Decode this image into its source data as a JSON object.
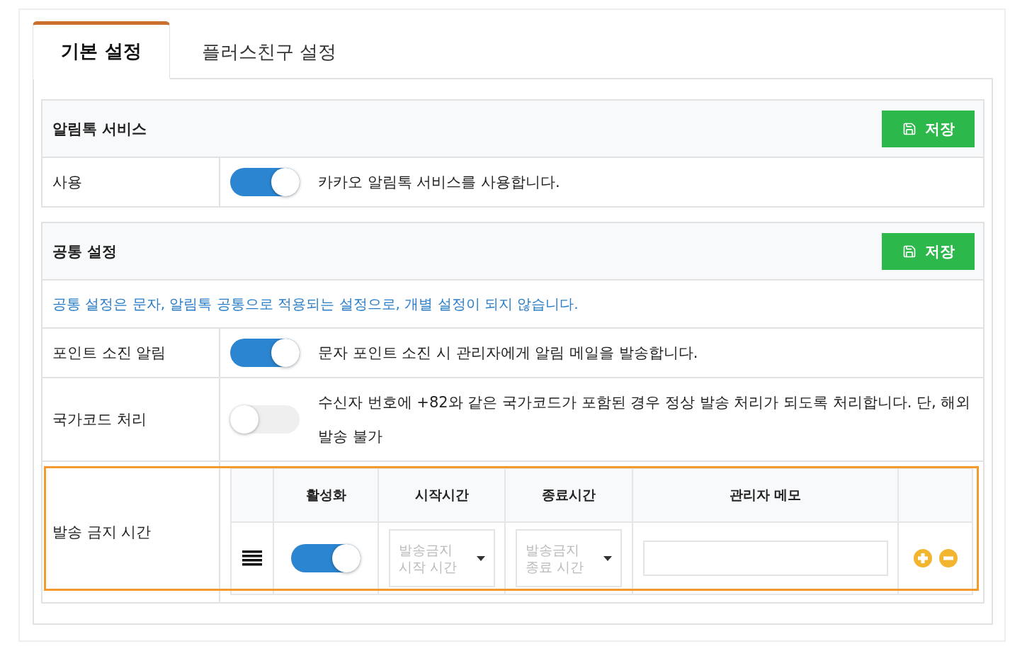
{
  "tabs": [
    {
      "label": "기본 설정",
      "selected": true
    },
    {
      "label": "플러스친구 설정",
      "selected": false
    }
  ],
  "sections": [
    {
      "title": "알림톡 서비스",
      "save_label": "저장",
      "rows": [
        {
          "kind": "toggle",
          "label": "사용",
          "on": true,
          "description": "카카오 알림톡 서비스를 사용합니다."
        }
      ]
    },
    {
      "title": "공통 설정",
      "save_label": "저장",
      "notice": "공통 설정은 문자, 알림톡 공통으로 적용되는 설정으로, 개별 설정이 되지 않습니다.",
      "rows": [
        {
          "kind": "toggle",
          "label": "포인트 소진 알림",
          "on": true,
          "description": "문자 포인트 소진 시 관리자에게 알림 메일을 발송합니다."
        },
        {
          "kind": "toggle",
          "label": "국가코드 처리",
          "on": false,
          "description": "수신자 번호에 +82와 같은 국가코드가 포함된 경우 정상 발송 처리가 되도록 처리합니다. 단, 해외 발송 불가"
        },
        {
          "kind": "schedule",
          "label": "발송 금지 시간",
          "highlighted": true,
          "columns": [
            "활성화",
            "시작시간",
            "종료시간",
            "관리자 메모"
          ],
          "rows": [
            {
              "on": true,
              "start_placeholder": "발송금지 시작 시간",
              "end_placeholder": "발송금지 종료 시간",
              "memo": ""
            }
          ]
        }
      ]
    }
  ]
}
